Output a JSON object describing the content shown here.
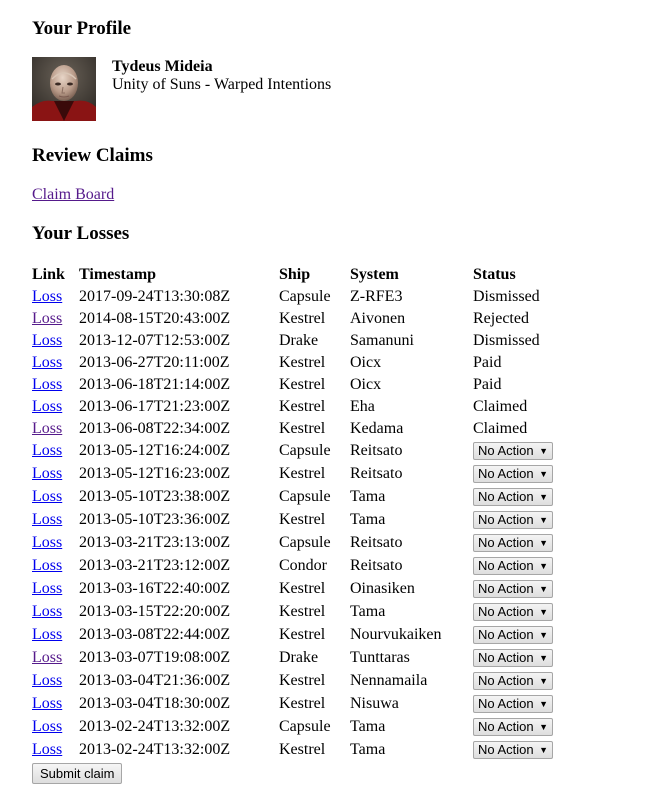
{
  "profile": {
    "heading": "Your Profile",
    "name": "Tydeus Mideia",
    "affiliation": "Unity of Suns - Warped Intentions"
  },
  "review": {
    "heading": "Review Claims",
    "claim_board_link": "Claim Board"
  },
  "losses": {
    "heading": "Your Losses",
    "columns": [
      "Link",
      "Timestamp",
      "Ship",
      "System",
      "Status"
    ],
    "rows": [
      {
        "link": "Loss",
        "timestamp": "2017-09-24T13:30:08Z",
        "ship": "Capsule",
        "system": "Z-RFE3",
        "status": "Dismissed",
        "visited": false
      },
      {
        "link": "Loss",
        "timestamp": "2014-08-15T20:43:00Z",
        "ship": "Kestrel",
        "system": "Aivonen",
        "status": "Rejected",
        "visited": true
      },
      {
        "link": "Loss",
        "timestamp": "2013-12-07T12:53:00Z",
        "ship": "Drake",
        "system": "Samanuni",
        "status": "Dismissed",
        "visited": false
      },
      {
        "link": "Loss",
        "timestamp": "2013-06-27T20:11:00Z",
        "ship": "Kestrel",
        "system": "Oicx",
        "status": "Paid",
        "visited": false
      },
      {
        "link": "Loss",
        "timestamp": "2013-06-18T21:14:00Z",
        "ship": "Kestrel",
        "system": "Oicx",
        "status": "Paid",
        "visited": false
      },
      {
        "link": "Loss",
        "timestamp": "2013-06-17T21:23:00Z",
        "ship": "Kestrel",
        "system": "Eha",
        "status": "Claimed",
        "visited": false
      },
      {
        "link": "Loss",
        "timestamp": "2013-06-08T22:34:00Z",
        "ship": "Kestrel",
        "system": "Kedama",
        "status": "Claimed",
        "visited": true
      },
      {
        "link": "Loss",
        "timestamp": "2013-05-12T16:24:00Z",
        "ship": "Capsule",
        "system": "Reitsato",
        "action": "No Action",
        "visited": false
      },
      {
        "link": "Loss",
        "timestamp": "2013-05-12T16:23:00Z",
        "ship": "Kestrel",
        "system": "Reitsato",
        "action": "No Action",
        "visited": false
      },
      {
        "link": "Loss",
        "timestamp": "2013-05-10T23:38:00Z",
        "ship": "Capsule",
        "system": "Tama",
        "action": "No Action",
        "visited": false
      },
      {
        "link": "Loss",
        "timestamp": "2013-05-10T23:36:00Z",
        "ship": "Kestrel",
        "system": "Tama",
        "action": "No Action",
        "visited": false
      },
      {
        "link": "Loss",
        "timestamp": "2013-03-21T23:13:00Z",
        "ship": "Capsule",
        "system": "Reitsato",
        "action": "No Action",
        "visited": false
      },
      {
        "link": "Loss",
        "timestamp": "2013-03-21T23:12:00Z",
        "ship": "Condor",
        "system": "Reitsato",
        "action": "No Action",
        "visited": false
      },
      {
        "link": "Loss",
        "timestamp": "2013-03-16T22:40:00Z",
        "ship": "Kestrel",
        "system": "Oinasiken",
        "action": "No Action",
        "visited": false
      },
      {
        "link": "Loss",
        "timestamp": "2013-03-15T22:20:00Z",
        "ship": "Kestrel",
        "system": "Tama",
        "action": "No Action",
        "visited": false
      },
      {
        "link": "Loss",
        "timestamp": "2013-03-08T22:44:00Z",
        "ship": "Kestrel",
        "system": "Nourvukaiken",
        "action": "No Action",
        "visited": false
      },
      {
        "link": "Loss",
        "timestamp": "2013-03-07T19:08:00Z",
        "ship": "Drake",
        "system": "Tunttaras",
        "action": "No Action",
        "visited": true
      },
      {
        "link": "Loss",
        "timestamp": "2013-03-04T21:36:00Z",
        "ship": "Kestrel",
        "system": "Nennamaila",
        "action": "No Action",
        "visited": false
      },
      {
        "link": "Loss",
        "timestamp": "2013-03-04T18:30:00Z",
        "ship": "Kestrel",
        "system": "Nisuwa",
        "action": "No Action",
        "visited": false
      },
      {
        "link": "Loss",
        "timestamp": "2013-02-24T13:32:00Z",
        "ship": "Capsule",
        "system": "Tama",
        "action": "No Action",
        "visited": false
      },
      {
        "link": "Loss",
        "timestamp": "2013-02-24T13:32:00Z",
        "ship": "Kestrel",
        "system": "Tama",
        "action": "No Action",
        "visited": false
      }
    ],
    "submit_label": "Submit claim"
  },
  "colors": {
    "link_unvisited": "#0000ee",
    "link_visited": "#551a8b"
  }
}
